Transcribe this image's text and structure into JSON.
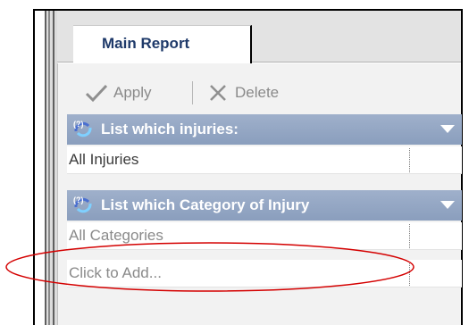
{
  "tabs": [
    {
      "label": "Main Report"
    }
  ],
  "toolbar": {
    "apply_label": "Apply",
    "delete_label": "Delete"
  },
  "sections": [
    {
      "header": "List which injuries:",
      "rows": [
        "All Injuries"
      ]
    },
    {
      "header": "List which Category of Injury",
      "rows": [
        "All Categories",
        "Click to Add..."
      ]
    }
  ],
  "colors": {
    "header_bg": "#8fa2c0",
    "tab_text": "#1f3a6a",
    "annotation": "#d40000"
  }
}
